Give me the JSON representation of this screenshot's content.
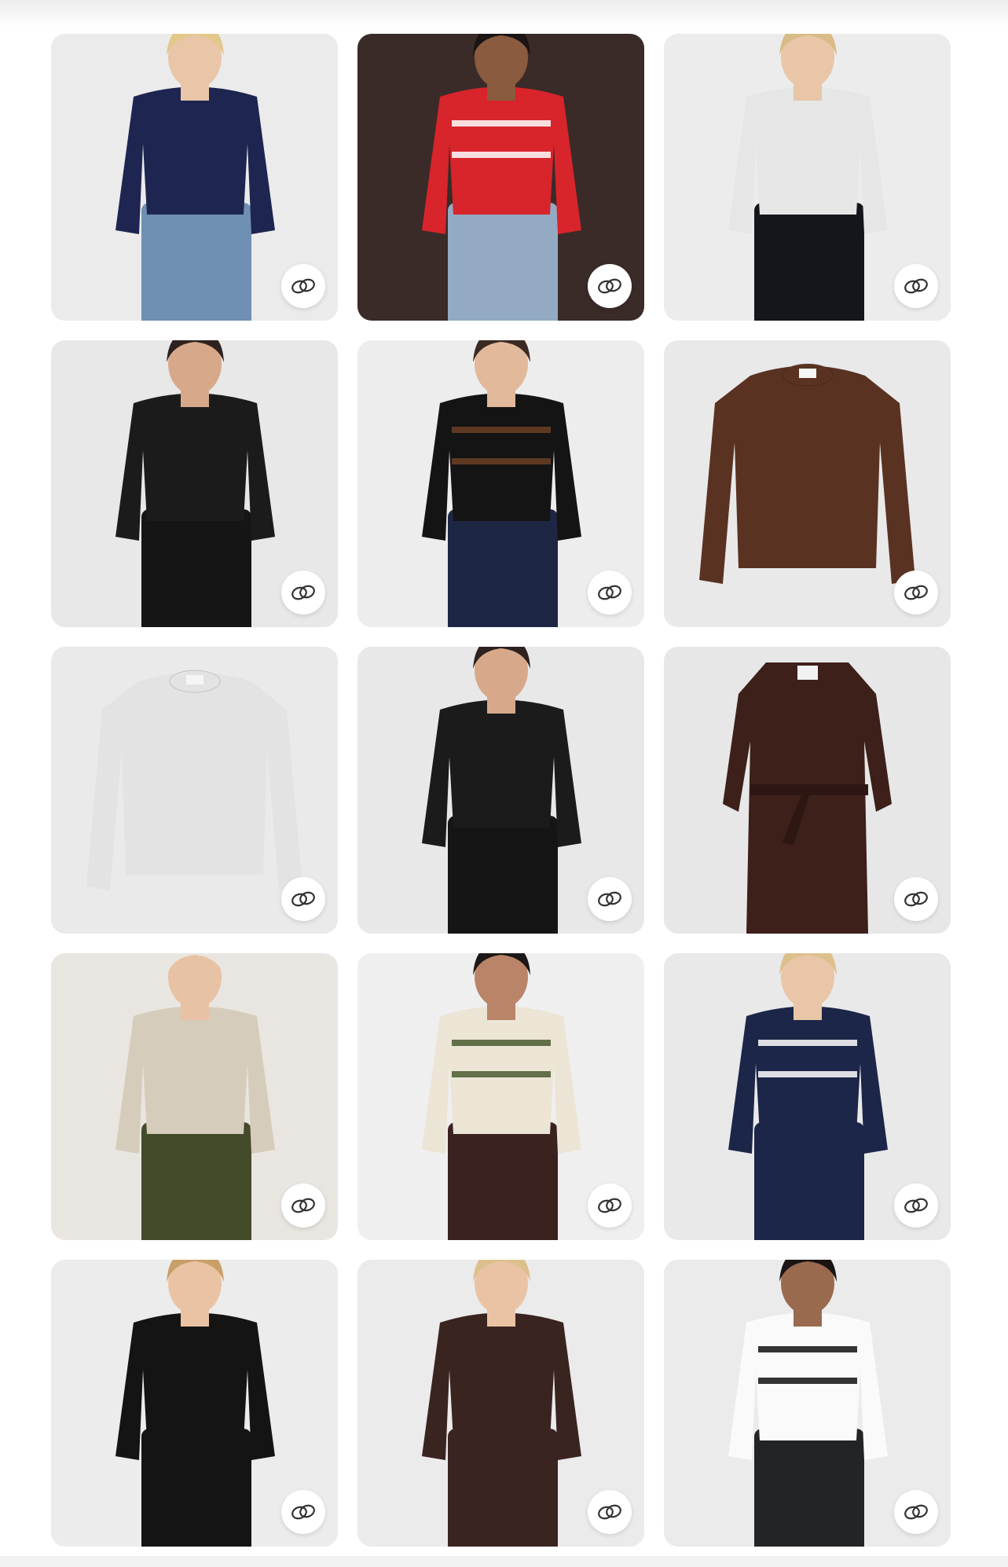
{
  "icons": {
    "link_icon": "interlocking-rings-link-icon"
  },
  "colors": {
    "card_background": "#ededed",
    "button_background": "#ffffff",
    "icon_stroke": "#333333"
  },
  "products": [
    {
      "garment": "navy-hoodie",
      "palette": {
        "bg": "#ebebeb",
        "top": "#1d2550",
        "bottom": "#6f8fb3",
        "skin": "#e9c6a8",
        "hair": "#e2c88a"
      }
    },
    {
      "garment": "red-striped-henley-sweater",
      "palette": {
        "bg": "#3a2b28",
        "top": "#d8242b",
        "bottom": "#94aac3",
        "skin": "#8a5b3f",
        "hair": "#1a1414",
        "accent": "#ffffff"
      }
    },
    {
      "garment": "black-wide-leg-pants-white-tank",
      "palette": {
        "bg": "#ececec",
        "top": "#e6e6e6",
        "bottom": "#14161c",
        "skin": "#e9c6a8",
        "hair": "#d8bb86"
      }
    },
    {
      "garment": "black-scoop-tank",
      "palette": {
        "bg": "#e8e8e8",
        "top": "#1b1b1c",
        "bottom": "#151515",
        "skin": "#d7a98a",
        "hair": "#2d2220"
      }
    },
    {
      "garment": "black-long-sleeve-top-dark-jeans",
      "palette": {
        "bg": "#ededed",
        "top": "#141414",
        "bottom": "#1d2744",
        "skin": "#e2b99b",
        "hair": "#3a2a22",
        "accent": "#6b3f24"
      }
    },
    {
      "garment": "brown-crewneck-sweater",
      "palette": {
        "bg": "#e9e9ea",
        "top": "#5a3222",
        "bottom": "#5a3222",
        "skin": "#e9e9ea",
        "hair": "#e9e9ea"
      }
    },
    {
      "garment": "grey-mock-neck-sweatshirt",
      "palette": {
        "bg": "#eaeaeb",
        "top": "#e3e3e4",
        "bottom": "#e3e3e4",
        "skin": "#eaeaeb",
        "hair": "#eaeaeb"
      }
    },
    {
      "garment": "black-scoop-tank-alt",
      "palette": {
        "bg": "#e8e8e8",
        "top": "#1b1b1c",
        "bottom": "#151515",
        "skin": "#d7a98a",
        "hair": "#2d2220"
      }
    },
    {
      "garment": "brown-belted-trench-coat",
      "palette": {
        "bg": "#e7e7e8",
        "top": "#3d2019",
        "bottom": "#3d2019",
        "skin": "#e7e7e8",
        "hair": "#e7e7e8"
      }
    },
    {
      "garment": "olive-green-jeans",
      "palette": {
        "bg": "#e9e6e1",
        "top": "#d6ccbb",
        "bottom": "#434b2a",
        "skin": "#e8c2a4",
        "hair": "#e9e6e1"
      }
    },
    {
      "garment": "brown-straight-pants-cami",
      "palette": {
        "bg": "#efefef",
        "top": "#ece5d6",
        "bottom": "#3a221f",
        "skin": "#b98468",
        "hair": "#1d1716",
        "accent": "#4a5a2f"
      }
    },
    {
      "garment": "navy-bomber-jacket",
      "palette": {
        "bg": "#e9e9ea",
        "top": "#1c2648",
        "bottom": "#1c2648",
        "skin": "#e9c6a8",
        "hair": "#dcc08c",
        "accent": "#ffffff"
      }
    },
    {
      "garment": "black-v-neck-long-sleeve",
      "palette": {
        "bg": "#ececec",
        "top": "#141414",
        "bottom": "#141414",
        "skin": "#eac3a5",
        "hair": "#c9a06a"
      }
    },
    {
      "garment": "brown-leather-moto-jacket",
      "palette": {
        "bg": "#ebebeb",
        "top": "#3a2420",
        "bottom": "#3a2420",
        "skin": "#eac3a5",
        "hair": "#dcc08c"
      }
    },
    {
      "garment": "white-baby-tee-black-shorts",
      "palette": {
        "bg": "#ebebeb",
        "top": "#fafafa",
        "bottom": "#232426",
        "skin": "#9a6a4f",
        "hair": "#1a1414",
        "accent": "#111111"
      }
    }
  ]
}
